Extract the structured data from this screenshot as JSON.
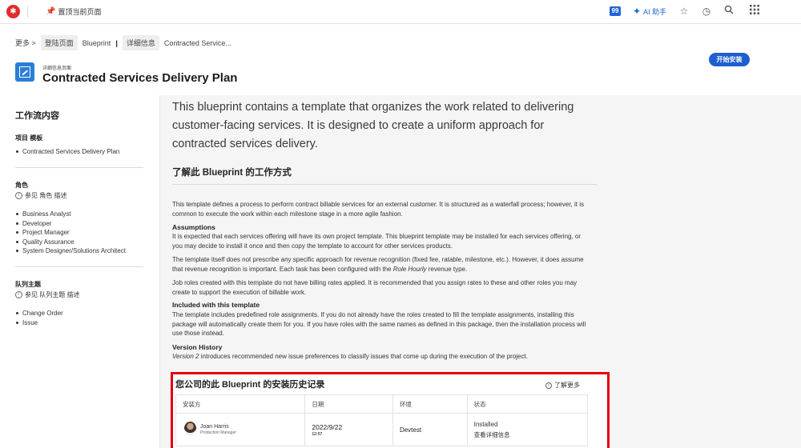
{
  "topbar": {
    "pin_label": "置顶当前页面",
    "count_badge": "99",
    "ai_label": "AI 助手"
  },
  "breadcrumb": {
    "more": "更多 >",
    "login_page": "登陆页面",
    "blueprint": "Blueprint",
    "separator": "|",
    "details": "详细信息",
    "current": "Contracted Service..."
  },
  "header": {
    "subtitle": "详细信息页面",
    "title": "Contracted Services Delivery Plan",
    "install_button": "开始安装"
  },
  "sidebar": {
    "title": "工作流内容",
    "project_head": "项目 模板",
    "projects": [
      "Contracted Services Delivery Plan"
    ],
    "roles_head": "角色",
    "roles_info": "参见 角色 描述",
    "roles": [
      "Business Analyst",
      "Developer",
      "Project Manager",
      "Quality Assurance",
      "System Designer/Solutions Architect"
    ],
    "teams_head": "队列主题",
    "teams_info": "参见 队列主题 描述",
    "teams": [
      "Change Order",
      "Issue"
    ]
  },
  "main": {
    "intro": "This blueprint contains a template that organizes the work related to delivering customer-facing services. It is designed to create a uniform approach for contracted services delivery.",
    "section_title": "了解此 Blueprint 的工作方式",
    "p1": "This template defines a process to perform contract billable services for an external customer. It is structured as a waterfall process; however, it is common to execute the work within each milestone stage in a more agile fashion.",
    "assumptions_head": "Assumptions",
    "p2": "It is expected that each services offering will have its own project template. This blueprint template may be installed for each services offering, or you may decide to install it once and then copy the template to account for other services products.",
    "p3a": "The template itself does not prescribe any specific approach for revenue recognition (fixed fee, ratable, milestone, etc.). However, it does assume that revenue recognition is important. Each task has been configured with the ",
    "p3em": "Role Hourly",
    "p3b": " revenue type.",
    "p4": "Job roles created with this template do not have billing rates applied. It is recommended that you assign rates to these and other roles you may create to support the execution of billable work.",
    "included_head": "Included with this template",
    "p5": "The template includes predefined role assignments. If you do not already have the roles created to fill the template assignments, installing this package will automatically create them for you. If you have roles with the same names as defined in this package, then the installation process will use those instead.",
    "version_head": "Version History",
    "p6em": "Version 2",
    "p6": " introduces recommended new issue preferences to classify issues that come up during the execution of the project."
  },
  "history": {
    "title": "您公司的此 Blueprint 的安装历史记录",
    "learn_more": "了解更多",
    "columns": [
      "安装方",
      "日期",
      "环境",
      "状态"
    ],
    "rows": [
      {
        "name": "Joan Harris",
        "role": "Production Manager",
        "date": "2022/9/22",
        "time": "12:57",
        "environment": "Devtest",
        "status": "Installed",
        "details_link": "查看详细信息"
      }
    ]
  },
  "colors": {
    "accent": "#1e5fcf",
    "highlight_border": "#e3000f",
    "logo": "#e12d2d"
  }
}
